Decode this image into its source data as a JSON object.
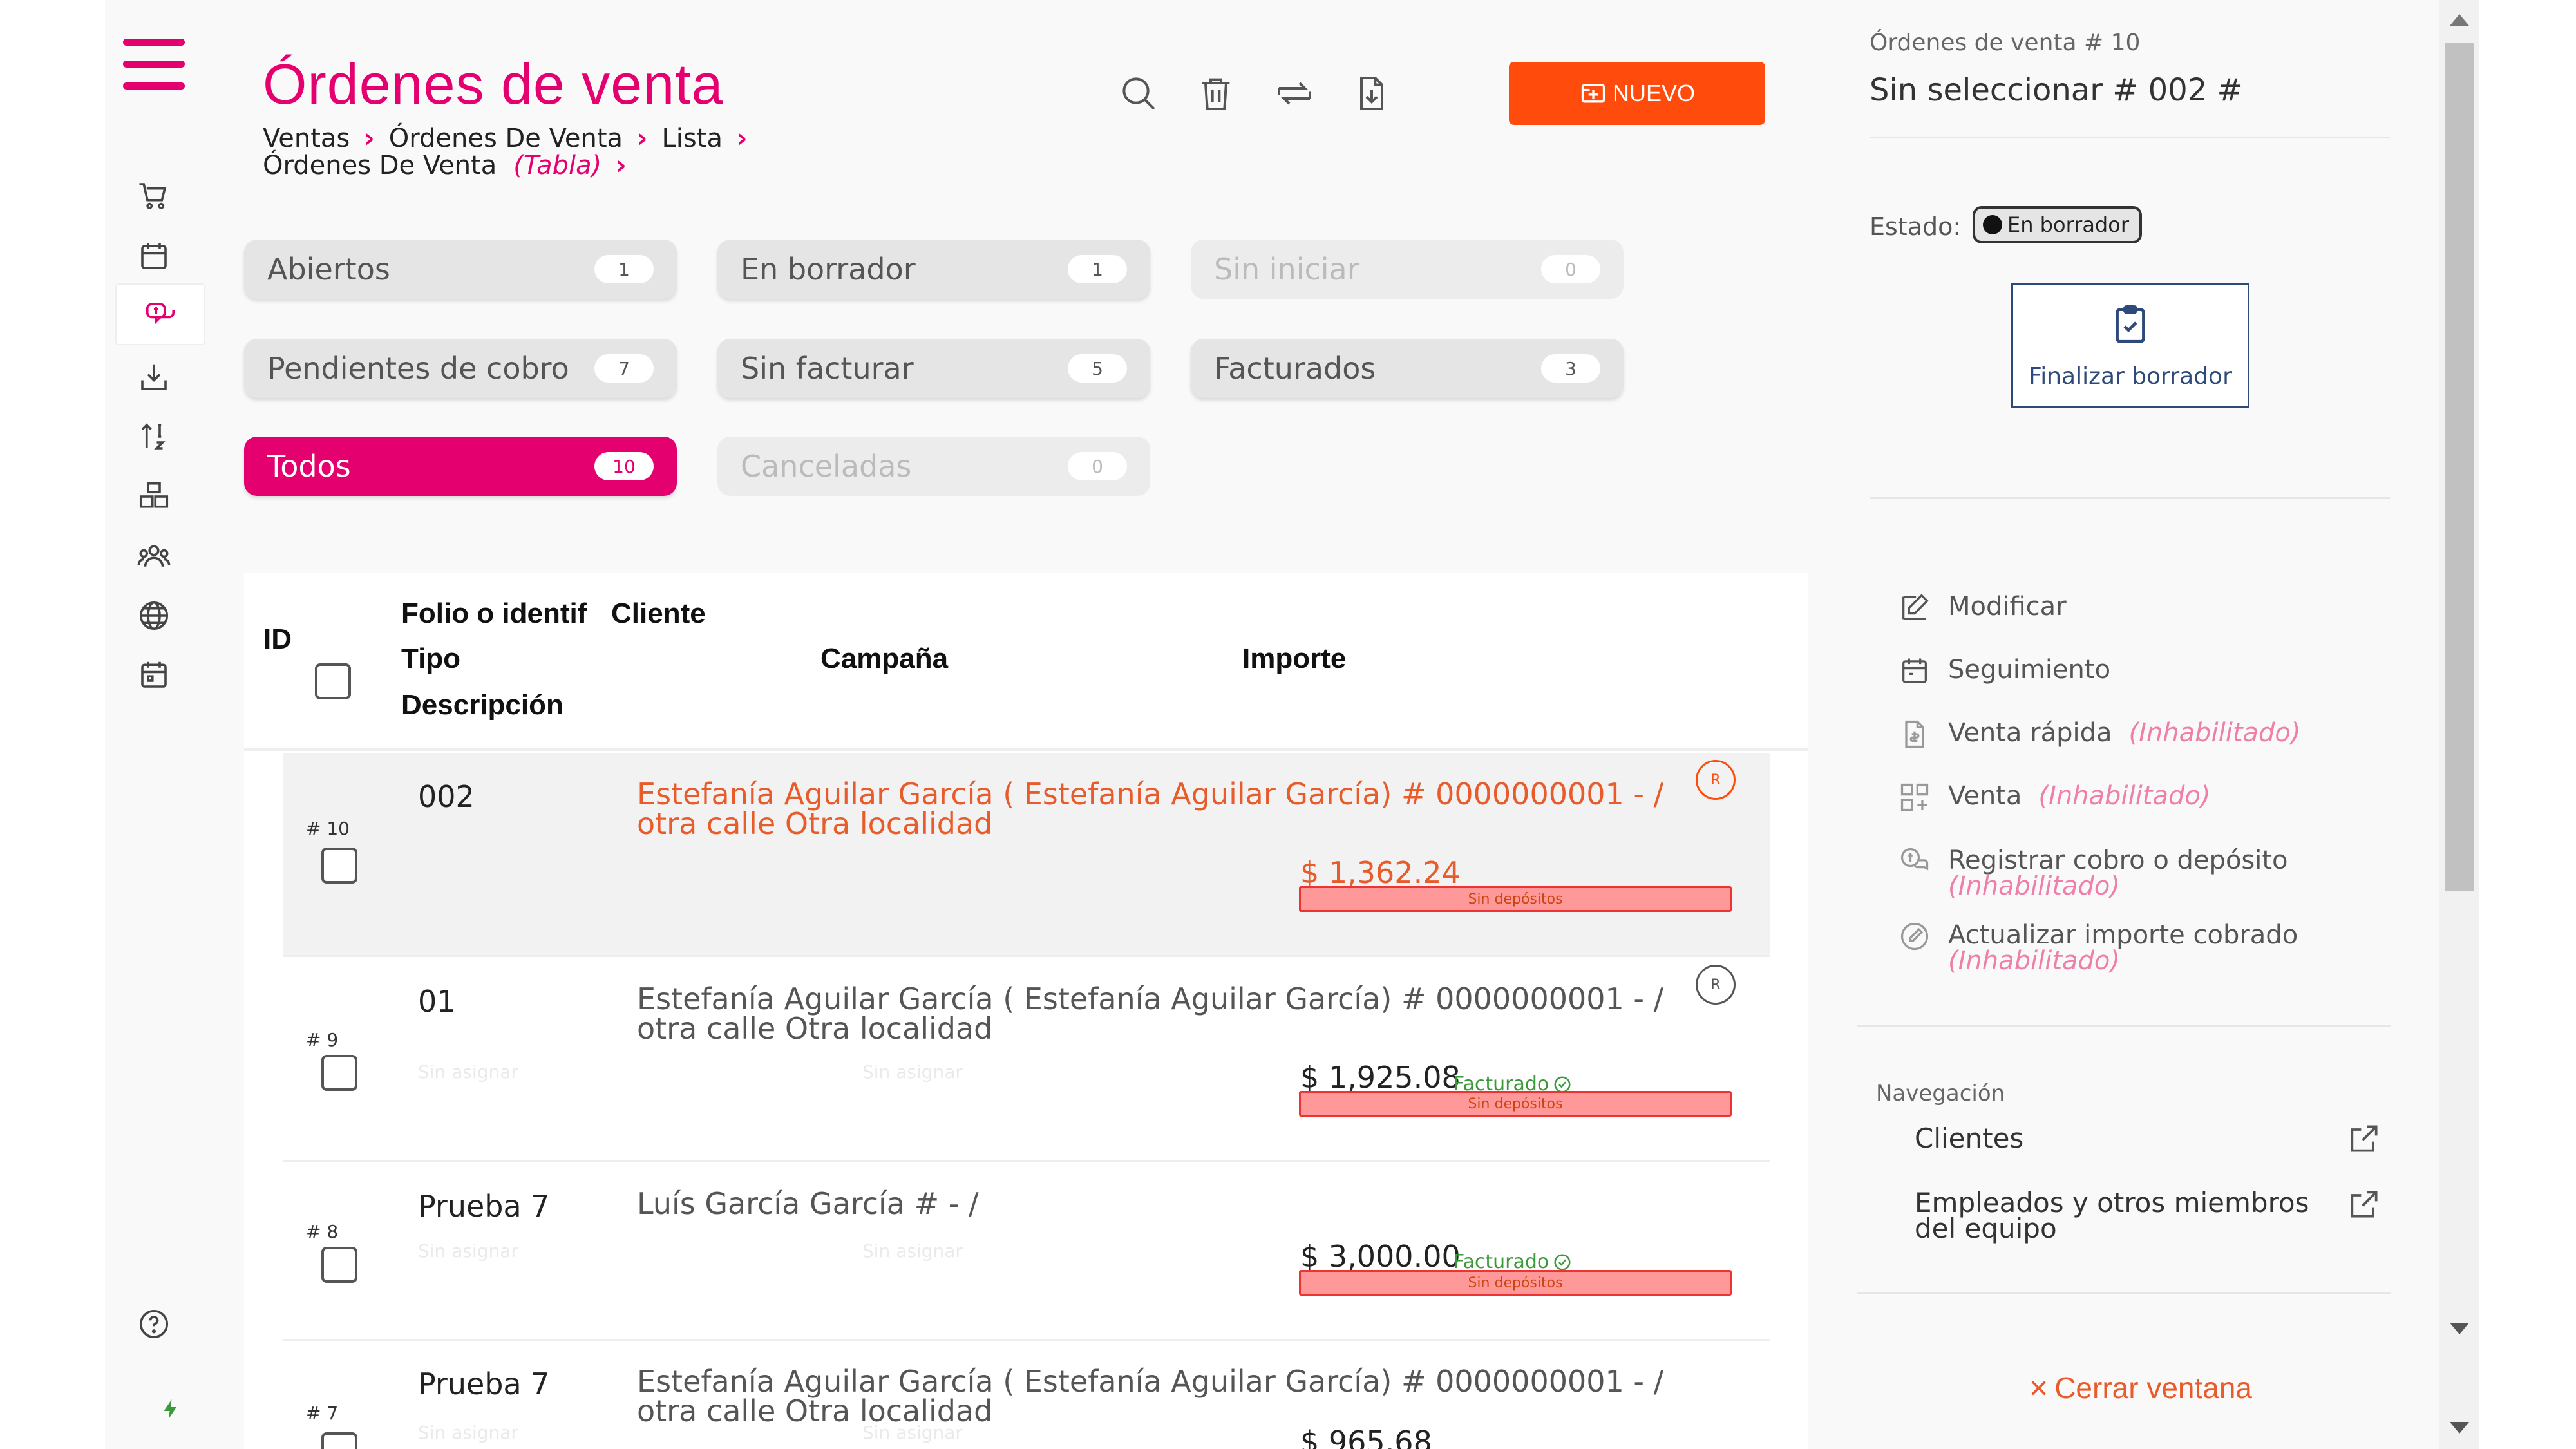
{
  "header": {
    "title": "Órdenes de venta",
    "breadcrumb": [
      "Ventas",
      "Órdenes De Venta",
      "Lista",
      "Órdenes De Venta"
    ],
    "breadcrumb_view": "(Tabla)",
    "new_button_label": "NUEVO"
  },
  "icons": {
    "search": "search-icon",
    "delete": "trash-icon",
    "sync": "sync-icon",
    "export": "export-icon"
  },
  "filters": [
    {
      "label": "Abiertos",
      "count": "1",
      "state": "normal"
    },
    {
      "label": "En borrador",
      "count": "1",
      "state": "normal"
    },
    {
      "label": "Sin iniciar",
      "count": "0",
      "state": "disabled"
    },
    {
      "label": "Pendientes de cobro",
      "count": "7",
      "state": "normal"
    },
    {
      "label": "Sin facturar",
      "count": "5",
      "state": "normal"
    },
    {
      "label": "Facturados",
      "count": "3",
      "state": "normal"
    },
    {
      "label": "Todos",
      "count": "10",
      "state": "active"
    },
    {
      "label": "Canceladas",
      "count": "0",
      "state": "disabled"
    }
  ],
  "table": {
    "headers": {
      "id": "ID",
      "folio": "Folio o identificador",
      "tipo": "Tipo",
      "descripcion": "Descripción",
      "cliente": "Cliente",
      "campana": "Campaña",
      "importe": "Importe"
    },
    "rows": [
      {
        "id": "# 10",
        "folio": "002",
        "client": "Estefanía Aguilar García ( Estefanía Aguilar García) # 0000000001 - / otra calle Otra localidad",
        "amount": "$ 1,362.24",
        "status": "",
        "deposit": "Sin depósitos",
        "badge": "R",
        "unassigned": ""
      },
      {
        "id": "# 9",
        "folio": "01",
        "client": "Estefanía Aguilar García ( Estefanía Aguilar García) # 0000000001 - / otra calle Otra localidad",
        "amount": "$ 1,925.08",
        "status": "Facturado",
        "deposit": "Sin depósitos",
        "badge": "R",
        "unassigned": "Sin asignar"
      },
      {
        "id": "# 8",
        "folio": "Prueba 7",
        "client": "Luís García García # - /",
        "amount": "$ 3,000.00",
        "status": "Facturado",
        "deposit": "Sin depósitos",
        "badge": "",
        "unassigned": "Sin asignar"
      },
      {
        "id": "# 7",
        "folio": "Prueba 7",
        "client": "Estefanía Aguilar García ( Estefanía Aguilar García) # 0000000001 - / otra calle Otra localidad",
        "amount": "$ 965.68",
        "status": "",
        "deposit": "",
        "badge": "",
        "unassigned": "Sin asignar"
      }
    ]
  },
  "panel": {
    "label": "Órdenes de venta # 10",
    "title": "Sin seleccionar # 002 #",
    "estado_label": "Estado:",
    "estado_value": "En borrador",
    "finalize_label": "Finalizar borrador",
    "actions": [
      {
        "label": "Modificar",
        "disabled": ""
      },
      {
        "label": "Seguimiento",
        "disabled": ""
      },
      {
        "label": "Venta rápida",
        "disabled": "(Inhabilitado)"
      },
      {
        "label": "Venta",
        "disabled": "(Inhabilitado)"
      },
      {
        "label": "Registrar cobro o depósito",
        "disabled": "(Inhabilitado)"
      },
      {
        "label": "Actualizar importe cobrado",
        "disabled": "(Inhabilitado)"
      }
    ],
    "nav_label": "Navegación",
    "nav_links": [
      "Clientes",
      "Empleados y otros miembros del equipo"
    ],
    "close_label": "Cerrar ventana"
  },
  "colors": {
    "brand": "#e5006f",
    "primary_action": "#ff4c0c",
    "accent_orange": "#e85c2b",
    "success": "#3a9a3a",
    "deposit_bar": "#ff9999"
  }
}
